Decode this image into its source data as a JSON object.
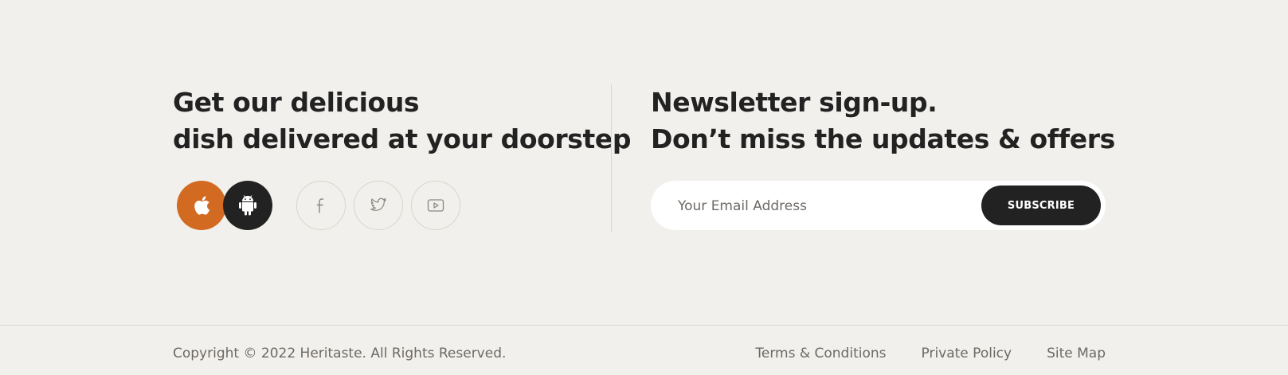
{
  "app_promo": {
    "heading_line1": "Get our delicious",
    "heading_line2": "dish delivered at your doorstep",
    "apple_icon": "apple-icon",
    "android_icon": "android-icon",
    "social": [
      {
        "icon": "facebook-icon"
      },
      {
        "icon": "twitter-icon"
      },
      {
        "icon": "youtube-icon"
      }
    ]
  },
  "newsletter": {
    "heading_line1": "Newsletter sign-up.",
    "heading_line2": "Don’t miss the updates & offers",
    "email_placeholder": "Your Email Address",
    "email_value": "",
    "subscribe_label": "SUBSCRIBE"
  },
  "footer": {
    "copyright": "Copyright © 2022 Heritaste. All Rights Reserved.",
    "links": [
      {
        "label": "Terms & Conditions"
      },
      {
        "label": "Private Policy"
      },
      {
        "label": "Site Map"
      }
    ]
  },
  "colors": {
    "background": "#f2f0ec",
    "accent_orange": "#d26a22",
    "dark": "#222222",
    "muted_text": "#6d6a66"
  }
}
